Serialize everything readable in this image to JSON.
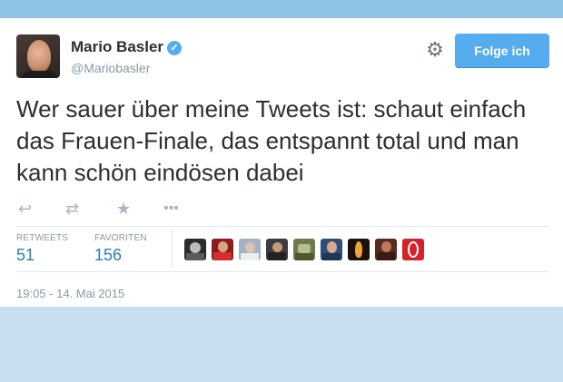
{
  "tweet": {
    "author_name": "Mario Basler",
    "author_handle": "@Mariobasler",
    "follow_label": "Folge ich",
    "text": "Wer sauer über meine Tweets ist: schaut einfach das Frauen-Finale, das entspannt total und man kann schön eindösen dabei",
    "timestamp": "19:05 - 14. Mai 2015"
  },
  "stats": {
    "retweets_label": "RETWEETS",
    "retweets_count": "51",
    "favorites_label": "FAVORITEN",
    "favorites_count": "156"
  },
  "icons": {
    "verified": "verified-badge-icon",
    "settings": "gear-icon",
    "reply": "reply-icon",
    "retweet": "retweet-icon",
    "favorite": "star-icon",
    "more": "more-dots-icon"
  },
  "colors": {
    "accent": "#55acee",
    "link": "#2b7bb9",
    "text": "#292f33",
    "muted": "#8899a6",
    "background": "#c7dff0",
    "top_band": "#8ec3e6"
  },
  "favoriters_count": 9
}
